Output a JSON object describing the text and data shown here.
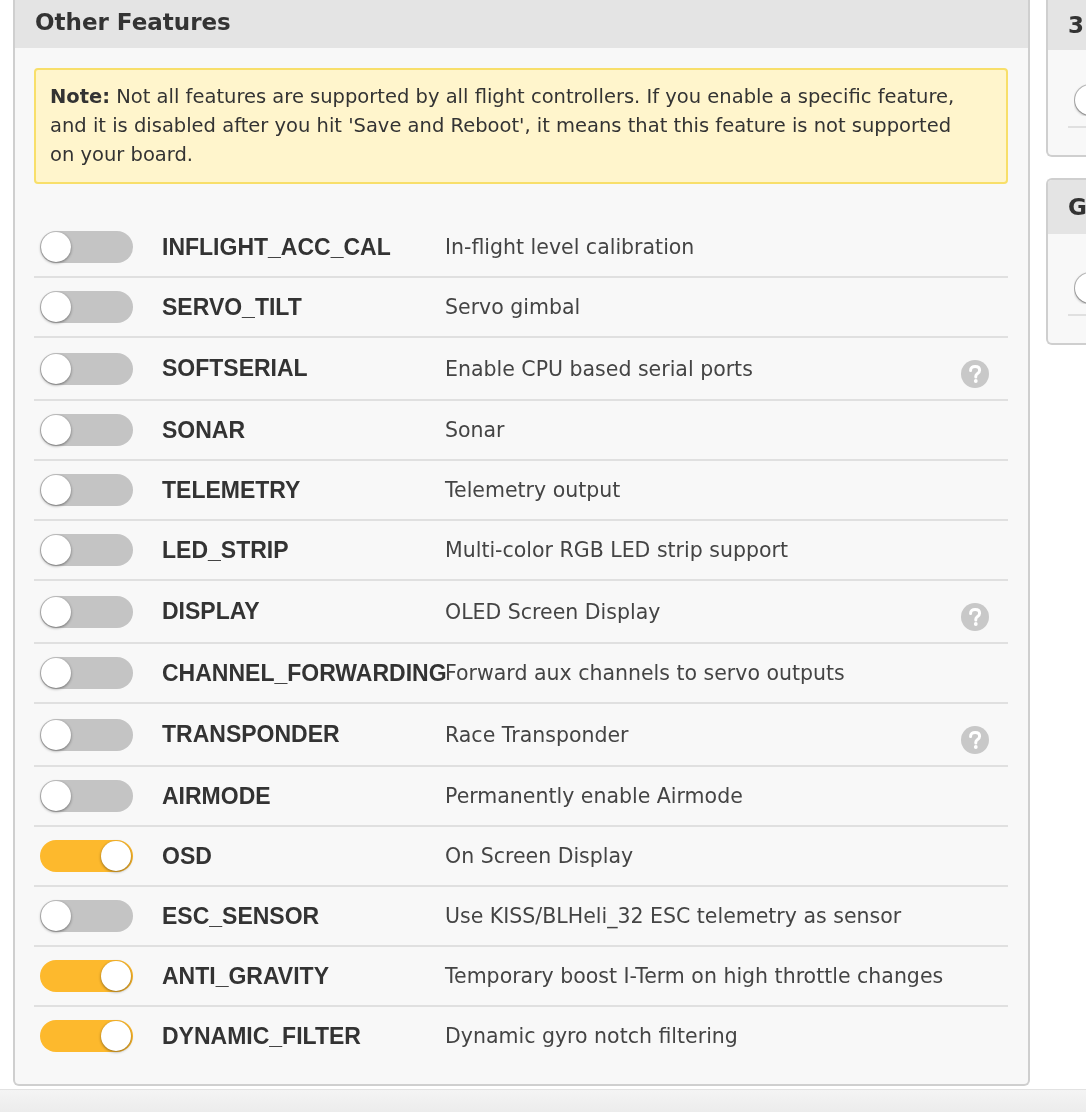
{
  "panel": {
    "title": "Other Features",
    "note": "**Note:** Not all features are supported by all flight controllers. If you enable a specific feature, and it is disabled after you hit 'Save and Reboot', it means that this feature is not supported on your board.",
    "features": [
      {
        "name": "INFLIGHT_ACC_CAL",
        "description": "In-flight level calibration",
        "enabled": false,
        "help": false
      },
      {
        "name": "SERVO_TILT",
        "description": "Servo gimbal",
        "enabled": false,
        "help": false
      },
      {
        "name": "SOFTSERIAL",
        "description": "Enable CPU based serial ports",
        "enabled": false,
        "help": true
      },
      {
        "name": "SONAR",
        "description": "Sonar",
        "enabled": false,
        "help": false
      },
      {
        "name": "TELEMETRY",
        "description": "Telemetry output",
        "enabled": false,
        "help": false
      },
      {
        "name": "LED_STRIP",
        "description": "Multi-color RGB LED strip support",
        "enabled": false,
        "help": false
      },
      {
        "name": "DISPLAY",
        "description": "OLED Screen Display",
        "enabled": false,
        "help": true
      },
      {
        "name": "CHANNEL_FORWARDING",
        "description": "Forward aux channels to servo outputs",
        "enabled": false,
        "help": false
      },
      {
        "name": "TRANSPONDER",
        "description": "Race Transponder",
        "enabled": false,
        "help": true
      },
      {
        "name": "AIRMODE",
        "description": "Permanently enable Airmode",
        "enabled": false,
        "help": false
      },
      {
        "name": "OSD",
        "description": "On Screen Display",
        "enabled": true,
        "help": false
      },
      {
        "name": "ESC_SENSOR",
        "description": "Use KISS/BLHeli_32 ESC telemetry as sensor",
        "enabled": false,
        "help": false
      },
      {
        "name": "ANTI_GRAVITY",
        "description": "Temporary boost I-Term on high throttle changes",
        "enabled": true,
        "help": false
      },
      {
        "name": "DYNAMIC_FILTER",
        "description": "Dynamic gyro notch filtering",
        "enabled": true,
        "help": false
      }
    ]
  },
  "side_panels": [
    {
      "title": "3",
      "on": false
    },
    {
      "title": "G",
      "on": false
    }
  ]
}
